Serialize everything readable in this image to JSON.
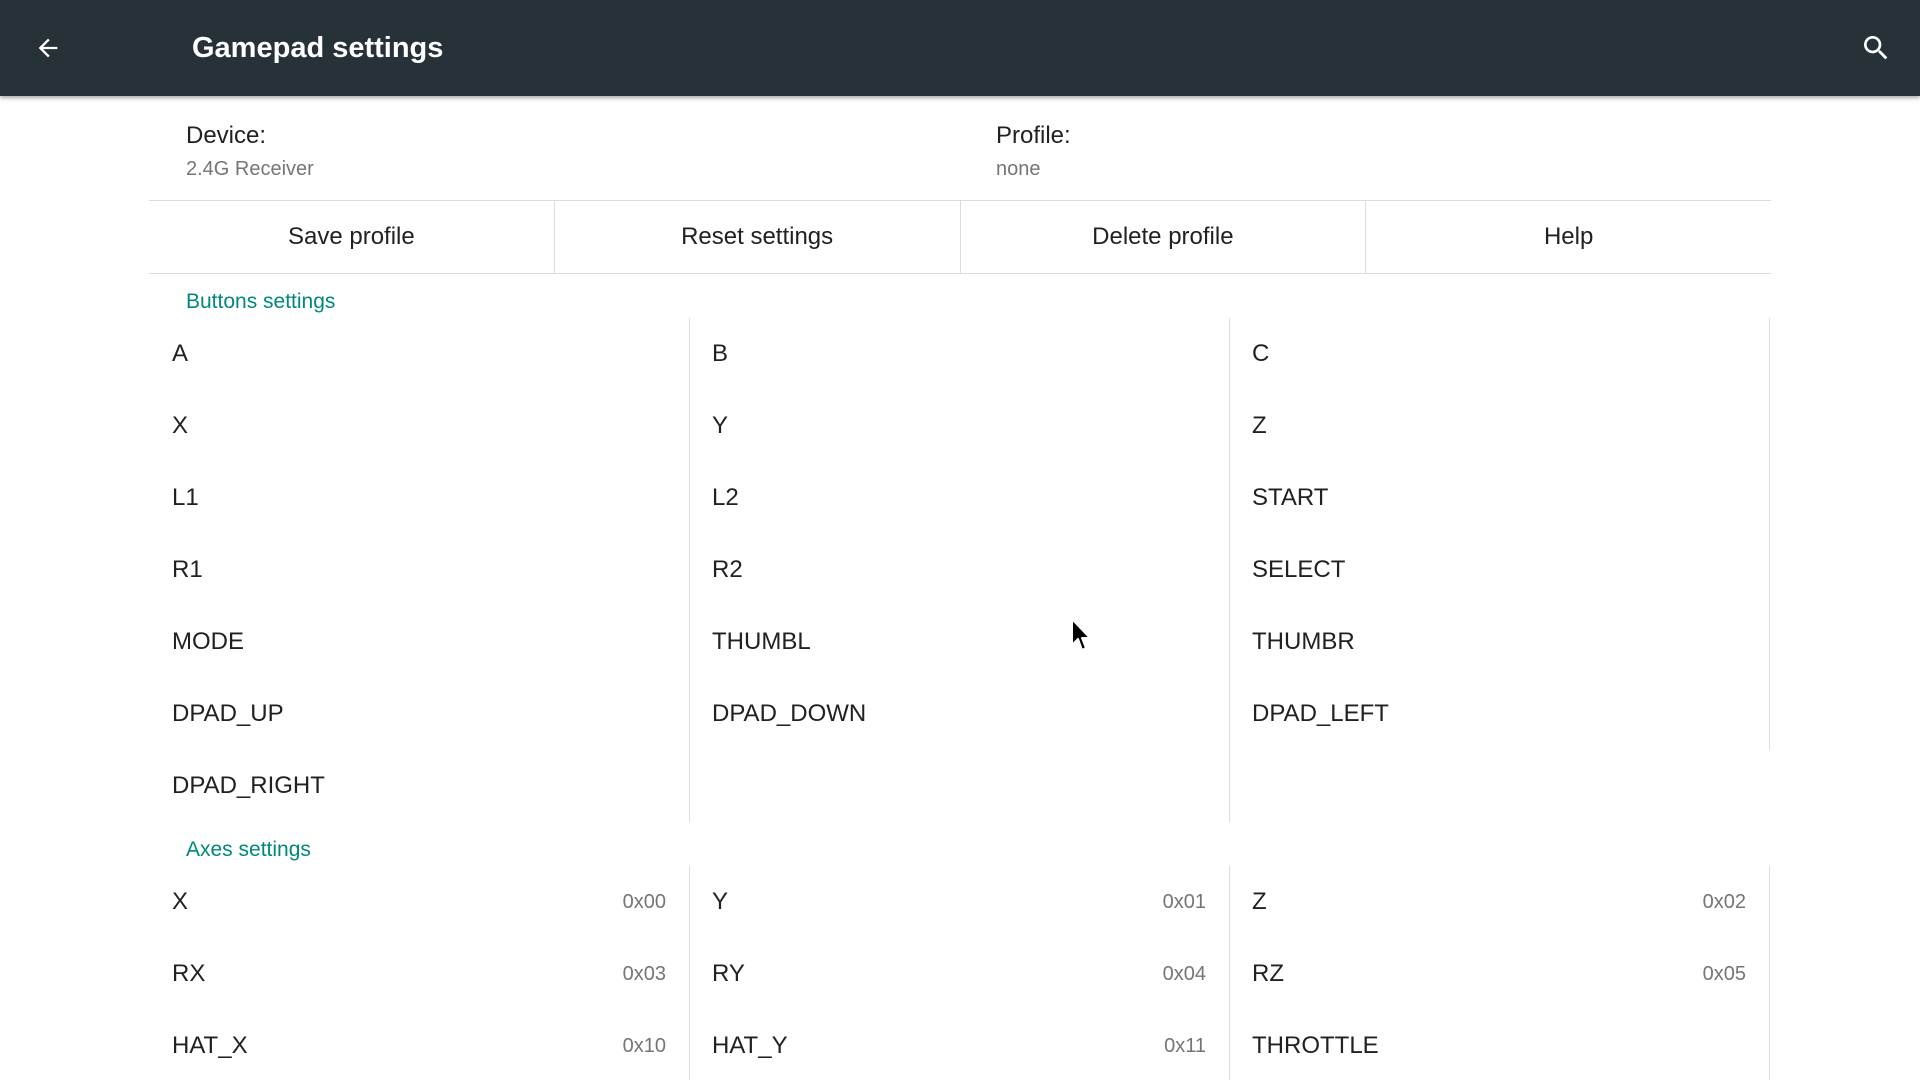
{
  "appbar": {
    "title": "Gamepad settings",
    "back_icon": "arrow-back-icon",
    "search_icon": "search-icon",
    "background": "#263238"
  },
  "device": {
    "label": "Device:",
    "value": "2.4G Receiver"
  },
  "profile": {
    "label": "Profile:",
    "value": "none"
  },
  "actions": {
    "save": "Save profile",
    "reset": "Reset settings",
    "delete": "Delete profile",
    "help": "Help"
  },
  "buttons_section": {
    "title": "Buttons settings",
    "accent": "#00897b",
    "columns": [
      [
        "A",
        "X",
        "L1",
        "R1",
        "MODE",
        "DPAD_UP",
        "DPAD_RIGHT"
      ],
      [
        "B",
        "Y",
        "L2",
        "R2",
        "THUMBL",
        "DPAD_DOWN"
      ],
      [
        "C",
        "Z",
        "START",
        "SELECT",
        "THUMBR",
        "DPAD_LEFT"
      ]
    ]
  },
  "axes_section": {
    "title": "Axes settings",
    "columns": [
      [
        {
          "name": "X",
          "code": "0x00"
        },
        {
          "name": "RX",
          "code": "0x03"
        },
        {
          "name": "HAT_X",
          "code": "0x10"
        }
      ],
      [
        {
          "name": "Y",
          "code": "0x01"
        },
        {
          "name": "RY",
          "code": "0x04"
        },
        {
          "name": "HAT_Y",
          "code": "0x11"
        }
      ],
      [
        {
          "name": "Z",
          "code": "0x02"
        },
        {
          "name": "RZ",
          "code": "0x05"
        },
        {
          "name": "THROTTLE",
          "code": ""
        }
      ]
    ]
  }
}
